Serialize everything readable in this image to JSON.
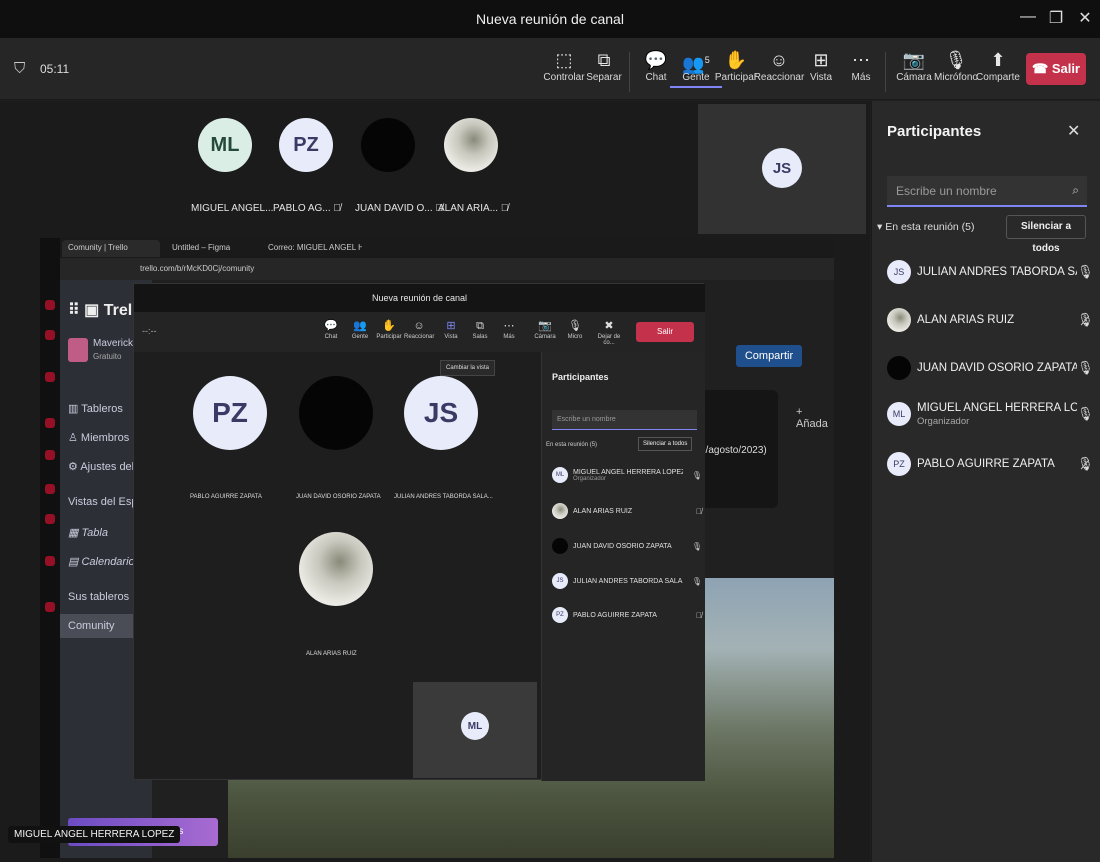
{
  "window": {
    "title": "Nueva reunión de canal",
    "controls": [
      "—",
      "❐",
      "✕"
    ]
  },
  "toolbar": {
    "timer": "05:11",
    "buttons": [
      {
        "label": "Controlar",
        "icon": "control-icon"
      },
      {
        "label": "Separar",
        "icon": "popout-icon"
      },
      {
        "label": "Chat",
        "icon": "chat-icon"
      },
      {
        "label": "Gente",
        "icon": "people-icon",
        "badge": "5",
        "active": true
      },
      {
        "label": "Participar",
        "icon": "raise-hand-icon"
      },
      {
        "label": "Reaccionar",
        "icon": "react-icon"
      },
      {
        "label": "Vista",
        "icon": "view-icon"
      },
      {
        "label": "Más",
        "icon": "more-icon"
      },
      {
        "label": "Cámara",
        "icon": "camera-off-icon"
      },
      {
        "label": "Micrófono",
        "icon": "mic-icon"
      },
      {
        "label": "Comparte",
        "icon": "share-icon"
      }
    ],
    "leave": "Salir"
  },
  "stage": {
    "tiles": [
      {
        "initials": "ML",
        "name": "MIGUEL ANGEL...",
        "muted": false
      },
      {
        "initials": "PZ",
        "name": "PABLO AG...",
        "muted": true
      },
      {
        "initials": "",
        "name": "JUAN DAVID O...",
        "muted": true
      },
      {
        "initials": "",
        "name": "ALAN ARIA...",
        "muted": true
      }
    ],
    "self_tile": "JS",
    "presenter_caption": "MIGUEL ANGEL HERRERA LOPEZ"
  },
  "shared": {
    "browser_tabs": [
      "Comunity | Trello",
      "Untitled – Figma",
      "Correo: MIGUEL ANGEL H..."
    ],
    "url": "trello.com/b/rMcKD0Cj/comunity",
    "trello": {
      "logo": "Trell",
      "workspace": "Mavericks",
      "plan": "Gratuito",
      "nav": [
        "Tableros",
        "Miembros",
        "Ajustes del"
      ],
      "views_header": "Vistas del Espac",
      "views": [
        "Tabla",
        "Calendario"
      ],
      "boards_header": "Sus tableros",
      "board": "Comunity",
      "share": "Compartir",
      "add": "+ Añada",
      "card_date": "3/agosto/2023)",
      "premium": "ium gratis"
    },
    "inner_meeting": {
      "title": "Nueva reunión de canal",
      "timer": "--:--",
      "buttons": [
        "Chat",
        "Gente",
        "Participar",
        "Reaccionar",
        "Vista",
        "Salas",
        "Más",
        "Cámara",
        "Micro",
        "Dejar de co..."
      ],
      "leave": "Salir",
      "tooltip": "Cambiar la vista",
      "tiles": [
        {
          "initials": "PZ",
          "name": "PABLO AGUIRRE ZAPATA"
        },
        {
          "initials": "",
          "name": "JUAN DAVID OSORIO ZAPATA"
        },
        {
          "initials": "JS",
          "name": "JULIAN ANDRES TABORDA SALA..."
        },
        {
          "initials": "",
          "name": "ALAN ARIAS RUIZ"
        }
      ],
      "self_tile": "ML",
      "panel": {
        "title": "Participantes",
        "search_placeholder": "Escribe un nombre",
        "section": "En esta reunión (5)",
        "mute_all": "Silenciar a todos",
        "people": [
          {
            "initials": "ML",
            "name": "MIGUEL ANGEL HERRERA LOPEZ",
            "role": "Organizador"
          },
          {
            "initials": "",
            "name": "ALAN ARIAS RUIZ"
          },
          {
            "initials": "",
            "name": "JUAN DAVID OSORIO ZAPATA"
          },
          {
            "initials": "JS",
            "name": "JULIAN ANDRES TABORDA SALA..."
          },
          {
            "initials": "PZ",
            "name": "PABLO AGUIRRE ZAPATA"
          }
        ]
      }
    }
  },
  "participants": {
    "title": "Participantes",
    "search_placeholder": "Escribe un nombre",
    "section": "En esta reunión (5)",
    "mute_all": "Silenciar a todos",
    "people": [
      {
        "initials": "JS",
        "name": "JULIAN ANDRES TABORDA SALA...",
        "role": "",
        "muted": false
      },
      {
        "initials": "",
        "name": "ALAN ARIAS RUIZ",
        "role": "",
        "muted": true
      },
      {
        "initials": "",
        "name": "JUAN DAVID OSORIO ZAPATA",
        "role": "",
        "muted": false
      },
      {
        "initials": "ML",
        "name": "MIGUEL ANGEL HERRERA LOPEZ",
        "role": "Organizador",
        "muted": false
      },
      {
        "initials": "PZ",
        "name": "PABLO AGUIRRE ZAPATA",
        "role": "",
        "muted": true
      }
    ]
  },
  "colors": {
    "accent": "#7f85f5",
    "leave": "#c4314b",
    "avatar": "#e8ebfa"
  }
}
